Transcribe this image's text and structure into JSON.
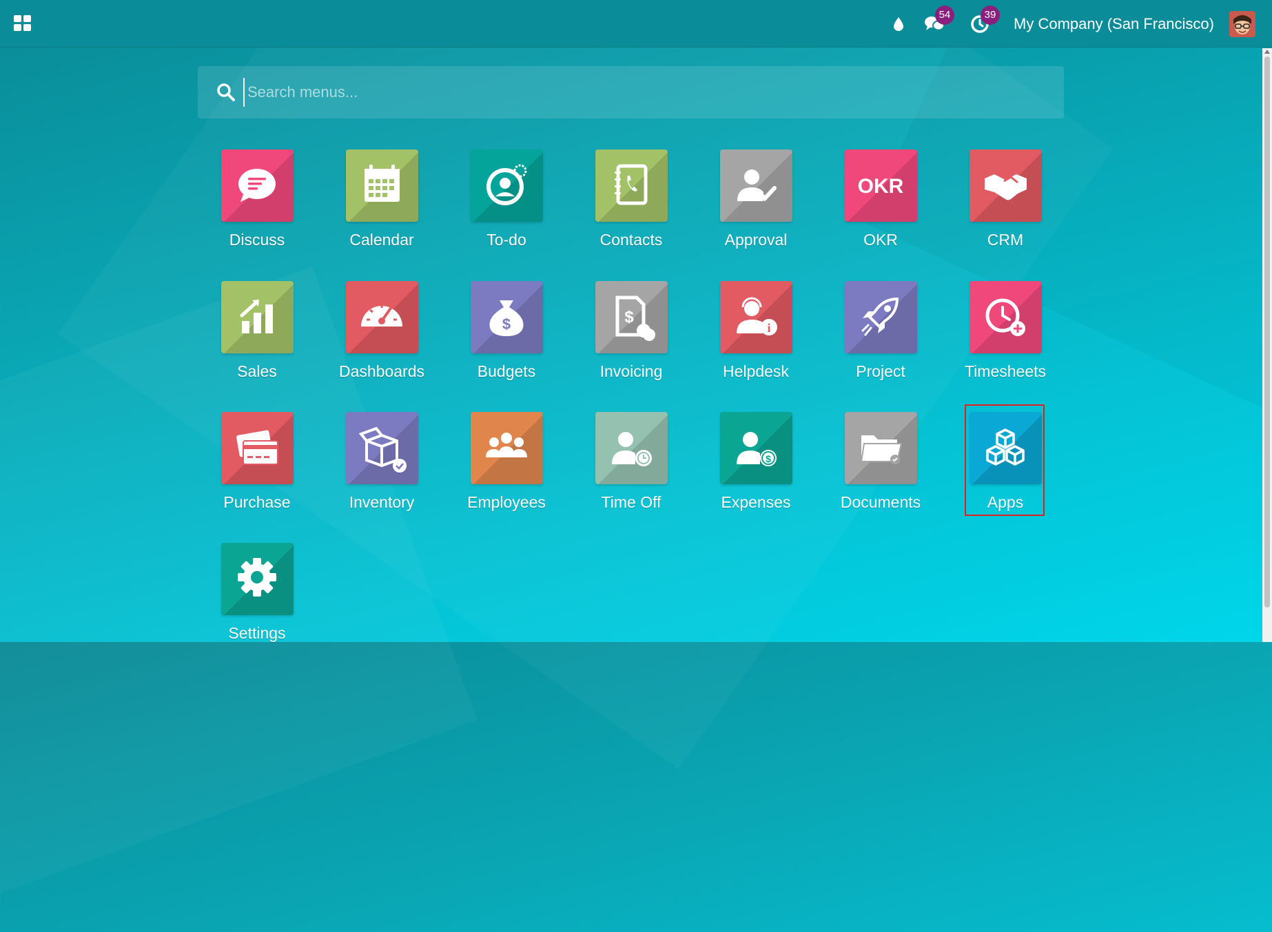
{
  "navbar": {
    "company": "My Company (San Francisco)",
    "messages_count": "54",
    "activities_count": "39"
  },
  "search": {
    "placeholder": "Search menus..."
  },
  "apps": [
    {
      "label": "Discuss",
      "icon": "chat-bubble-icon",
      "color": "#f1487c"
    },
    {
      "label": "Calendar",
      "icon": "calendar-icon",
      "color": "#a3c267"
    },
    {
      "label": "To-do",
      "icon": "todo-user-gear-icon",
      "color": "#05a49b"
    },
    {
      "label": "Contacts",
      "icon": "address-book-icon",
      "color": "#a3c267"
    },
    {
      "label": "Approval",
      "icon": "user-check-icon",
      "color": "#a5a5a5"
    },
    {
      "label": "OKR",
      "icon": "okr-logo-icon",
      "color": "#f1487c"
    },
    {
      "label": "CRM",
      "icon": "handshake-icon",
      "color": "#e25a62"
    },
    {
      "label": "Sales",
      "icon": "bar-chart-up-icon",
      "color": "#a3c267"
    },
    {
      "label": "Dashboards",
      "icon": "speedometer-icon",
      "color": "#e25a62"
    },
    {
      "label": "Budgets",
      "icon": "money-bag-icon",
      "color": "#7c7bc1"
    },
    {
      "label": "Invoicing",
      "icon": "invoice-icon",
      "color": "#a5a5a5"
    },
    {
      "label": "Helpdesk",
      "icon": "support-agent-icon",
      "color": "#e25a62"
    },
    {
      "label": "Project",
      "icon": "rocket-icon",
      "color": "#7c7bc1"
    },
    {
      "label": "Timesheets",
      "icon": "clock-plus-icon",
      "color": "#f1487c"
    },
    {
      "label": "Purchase",
      "icon": "credit-card-icon",
      "color": "#e25a62"
    },
    {
      "label": "Inventory",
      "icon": "open-box-icon",
      "color": "#7c7bc1"
    },
    {
      "label": "Employees",
      "icon": "team-icon",
      "color": "#e0864d"
    },
    {
      "label": "Time Off",
      "icon": "user-clock-icon",
      "color": "#95c2b0"
    },
    {
      "label": "Expenses",
      "icon": "user-dollar-icon",
      "color": "#0aa593"
    },
    {
      "label": "Documents",
      "icon": "folder-icon",
      "color": "#a5a5a5"
    },
    {
      "label": "Apps",
      "icon": "cubes-icon",
      "color": "#0aa8d4"
    },
    {
      "label": "Settings",
      "icon": "gear-icon",
      "color": "#0aa593"
    }
  ]
}
